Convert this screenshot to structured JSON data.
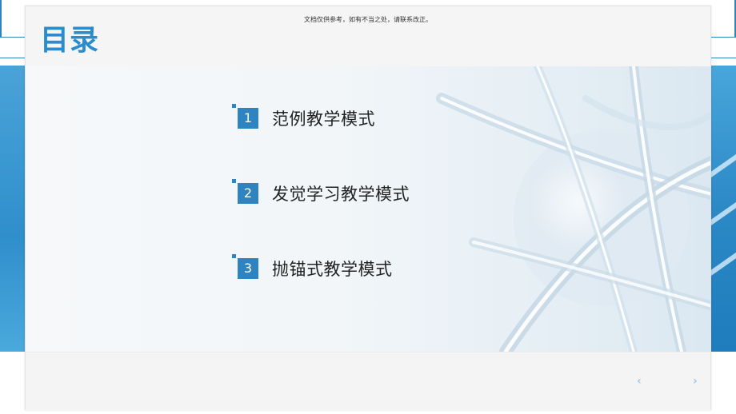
{
  "slide": {
    "title": "目录",
    "watermark": "文档仅供参考，如有不当之处，请联系改正。"
  },
  "menu": {
    "items": [
      {
        "number": "1",
        "label": "范例教学模式"
      },
      {
        "number": "2",
        "label": "发觉学习教学模式"
      },
      {
        "number": "3",
        "label": "抛锚式教学模式"
      }
    ]
  },
  "navigation": {
    "prev_glyph": "‹",
    "next_glyph": "›"
  },
  "colors": {
    "accent": "#2e84c0",
    "title": "#2a8ccd",
    "side_band": "#2f8fcb"
  }
}
